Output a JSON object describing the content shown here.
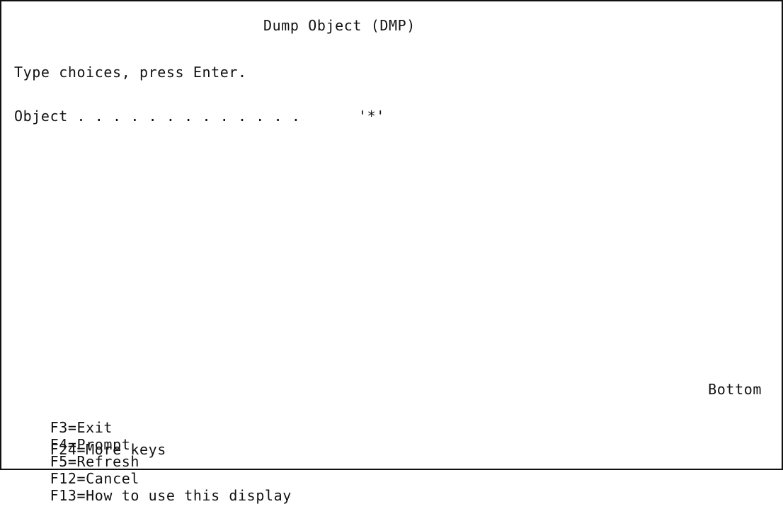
{
  "screen": {
    "title": "Dump Object (DMP)",
    "instruction": "Type choices, press Enter.",
    "object_field": {
      "label": "Object . . . . . . . . . . . . .",
      "value": "'*'"
    },
    "bottom_indicator": "Bottom",
    "function_keys_row1": [
      {
        "label": "F3=Exit"
      },
      {
        "label": "F4=Prompt"
      },
      {
        "label": "F5=Refresh"
      },
      {
        "label": "F12=Cancel"
      },
      {
        "label": "F13=How to use this display"
      }
    ],
    "function_keys_row2": [
      {
        "label": "F24=More keys"
      }
    ]
  }
}
